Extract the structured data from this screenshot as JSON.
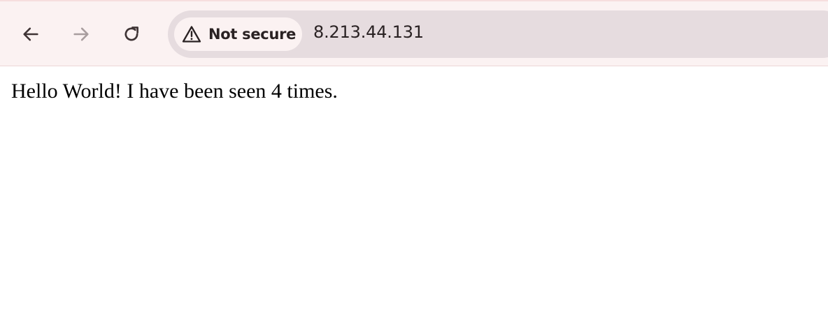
{
  "browser": {
    "toolbar": {
      "back_icon": "arrow-left-icon",
      "forward_icon": "arrow-right-icon",
      "reload_icon": "reload-icon"
    },
    "omnibox": {
      "security_icon": "warning-triangle-icon",
      "security_label": "Not secure",
      "url": "8.213.44.131"
    }
  },
  "page": {
    "body_text": "Hello World! I have been seen 4 times."
  },
  "colors": {
    "toolbar_bg": "#fbf2f2",
    "omnibox_bg": "#e6dcdf",
    "icon_active": "#3f3435",
    "icon_disabled": "#a89d9e"
  }
}
